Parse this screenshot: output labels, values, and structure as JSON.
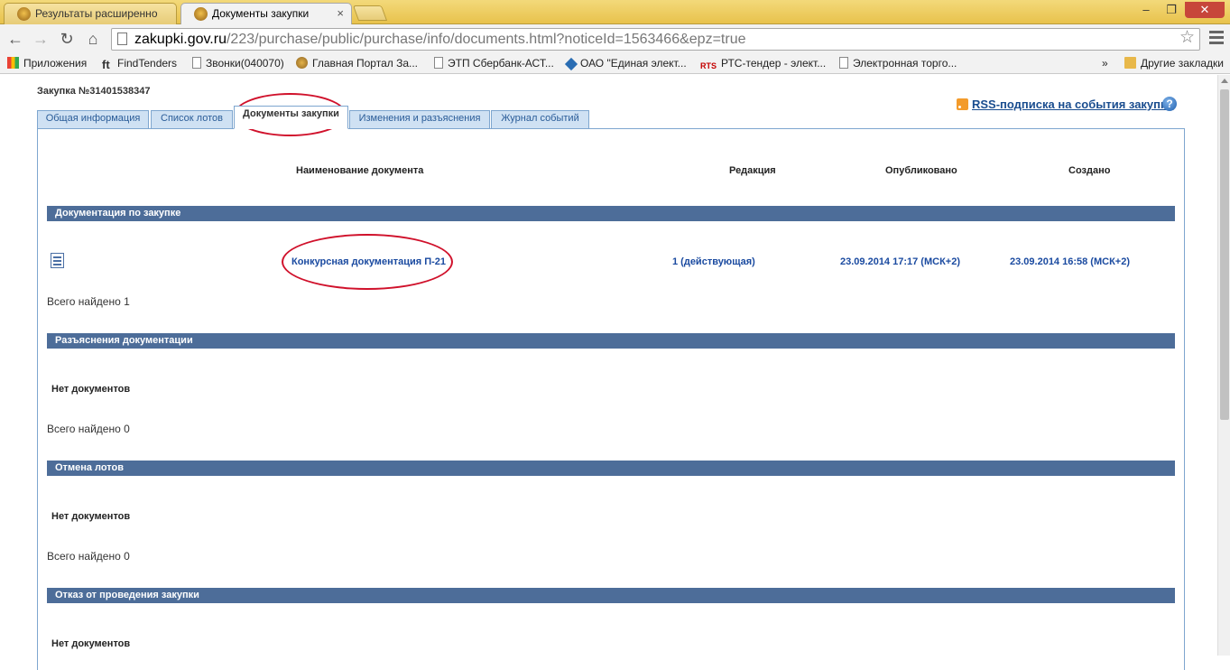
{
  "browser": {
    "tabs": [
      {
        "title": "Результаты расширенно"
      },
      {
        "title": "Документы закупки"
      }
    ],
    "url": {
      "host": "zakupki.gov.ru",
      "path": "/223/purchase/public/purchase/info/documents.html?noticeId=1563466&epz=true"
    },
    "window_controls": {
      "minimize": "–",
      "maximize": "❐",
      "close": "✕"
    },
    "bookmarks": [
      {
        "label": "Приложения",
        "icon": "apps-grid-icon"
      },
      {
        "label": "FindTenders",
        "icon": "findtenders-icon"
      },
      {
        "label": "Звонки(040070)",
        "icon": "page-icon"
      },
      {
        "label": "Главная Портал За...",
        "icon": "eagle-icon"
      },
      {
        "label": "ЭТП Сбербанк-АСТ...",
        "icon": "page-icon"
      },
      {
        "label": "ОАО \"Единая элект...",
        "icon": "diamond-icon"
      },
      {
        "label": "РТС-тендер - элект...",
        "icon": "rts-icon"
      },
      {
        "label": "Электронная торго...",
        "icon": "page-icon"
      }
    ],
    "bookmarks_overflow": "»",
    "other_bookmarks": "Другие закладки",
    "rts_badge": "RTS",
    "ft_badge": "ft"
  },
  "page": {
    "purchase_title": "Закупка №31401538347",
    "rss_link": "RSS-подписка на события закупки",
    "help": "?",
    "tabs": [
      {
        "label": "Общая информация"
      },
      {
        "label": "Список лотов"
      },
      {
        "label": "Документы закупки"
      },
      {
        "label": "Изменения и разъяснения"
      },
      {
        "label": "Журнал событий"
      }
    ],
    "active_tab": "Документы закупки",
    "columns": {
      "name": "Наименование документа",
      "edition": "Редакция",
      "published": "Опубликовано",
      "created": "Создано"
    },
    "sections": [
      {
        "title": "Документация по закупке",
        "rows": [
          {
            "name": "Конкурсная документация П-21",
            "edition": "1 (действующая)",
            "published": "23.09.2014 17:17 (МСК+2)",
            "created": "23.09.2014 16:58 (МСК+2)"
          }
        ],
        "total": "Всего найдено 1"
      },
      {
        "title": "Разъяснения документации",
        "empty": "Нет документов",
        "total": "Всего найдено 0"
      },
      {
        "title": "Отмена лотов",
        "empty": "Нет документов",
        "total": "Всего найдено 0"
      },
      {
        "title": "Отказ от проведения закупки",
        "empty": "Нет документов"
      }
    ]
  },
  "annotation_color": "#d0112b"
}
